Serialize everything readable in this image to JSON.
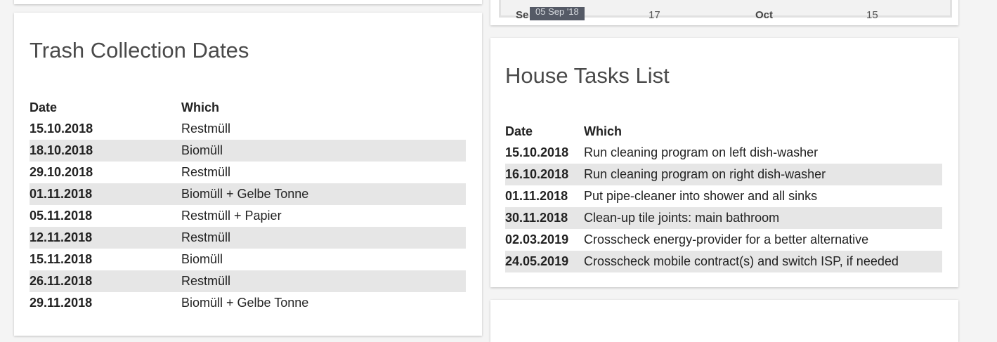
{
  "trash_card": {
    "title": "Trash Collection Dates",
    "columns": [
      "Date",
      "Which"
    ],
    "rows": [
      {
        "date": "15.10.2018",
        "which": "Restmüll"
      },
      {
        "date": "18.10.2018",
        "which": "Biomüll"
      },
      {
        "date": "29.10.2018",
        "which": "Restmüll"
      },
      {
        "date": "01.11.2018",
        "which": "Biomüll + Gelbe Tonne"
      },
      {
        "date": "05.11.2018",
        "which": "Restmüll + Papier"
      },
      {
        "date": "12.11.2018",
        "which": "Restmüll"
      },
      {
        "date": "15.11.2018",
        "which": "Biomüll"
      },
      {
        "date": "26.11.2018",
        "which": "Restmüll"
      },
      {
        "date": "29.11.2018",
        "which": "Biomüll + Gelbe Tonne"
      }
    ]
  },
  "tasks_card": {
    "title": "House Tasks List",
    "columns": [
      "Date",
      "Which"
    ],
    "rows": [
      {
        "date": "15.10.2018",
        "which": "Run cleaning program on left dish-washer"
      },
      {
        "date": "16.10.2018",
        "which": "Run cleaning program on right dish-washer"
      },
      {
        "date": "01.11.2018",
        "which": "Put pipe-cleaner into shower and all sinks"
      },
      {
        "date": "30.11.2018",
        "which": "Clean-up tile joints: main bathroom"
      },
      {
        "date": "02.03.2019",
        "which": "Crosscheck energy-provider for a better alternative"
      },
      {
        "date": "24.05.2019",
        "which": "Crosscheck mobile contract(s) and switch ISP, if needed"
      }
    ]
  },
  "chart_strip": {
    "axis_labels": [
      "Se",
      "17",
      "Oct",
      "15"
    ],
    "tooltip": "05 Sep '18"
  },
  "colors": {
    "page_background": "#f4f4f4",
    "card_background": "#ffffff",
    "row_stripe": "#e6e6e6",
    "tooltip_background": "#555a66"
  }
}
